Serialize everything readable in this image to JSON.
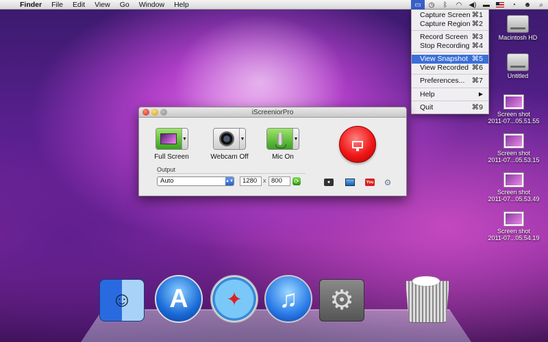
{
  "menubar": {
    "app": "Finder",
    "items": [
      "File",
      "Edit",
      "View",
      "Go",
      "Window",
      "Help"
    ],
    "status_icons": [
      "iscreenior-icon",
      "timemachine-icon",
      "bluetooth-icon",
      "wifi-icon",
      "volume-icon",
      "battery-icon",
      "flag-us-icon",
      "clock-icon",
      "user-icon",
      "spotlight-icon"
    ]
  },
  "dropdown": {
    "items": [
      {
        "label": "Capture Screen",
        "shortcut": "⌘1"
      },
      {
        "label": "Capture Region",
        "shortcut": "⌘2"
      },
      {
        "label": "Record Screen",
        "shortcut": "⌘3"
      },
      {
        "label": "Stop Recording",
        "shortcut": "⌘4"
      },
      {
        "label": "View Snapshot",
        "shortcut": "⌘5"
      },
      {
        "label": "View Recorded",
        "shortcut": "⌘6"
      },
      {
        "label": "Preferences...",
        "shortcut": "⌘7"
      },
      {
        "label": "Help",
        "shortcut": "▶"
      },
      {
        "label": "Quit",
        "shortcut": "⌘9"
      }
    ],
    "highlighted": "View Snapshot"
  },
  "desktop": {
    "drives": [
      {
        "label": "Macintosh HD"
      },
      {
        "label": "Untitled"
      }
    ],
    "screenshots": [
      {
        "line1": "Screen shot",
        "line2": "2011-07...05.51.55"
      },
      {
        "line1": "Screen shot",
        "line2": "2011-07...05.53.15"
      },
      {
        "line1": "Screen shot",
        "line2": "2011-07...05.53.49"
      },
      {
        "line1": "Screen shot",
        "line2": "2011-07...05.54.19"
      }
    ]
  },
  "window": {
    "title": "iScreeniorPro",
    "full_screen_label": "Full Screen",
    "webcam_label": "Webcam Off",
    "mic_label": "Mic On",
    "output_label": "Output",
    "output_value": "Auto",
    "width_value": "1280",
    "x_sep": "x",
    "height_value": "800"
  },
  "dock": {
    "apps": [
      "Finder",
      "App Store",
      "Safari",
      "iTunes",
      "System Preferences",
      "Trash"
    ]
  },
  "colors": {
    "menu_highlight": "#3a6fd8",
    "record_red": "#f01818",
    "toggle_green": "#3aa020"
  }
}
